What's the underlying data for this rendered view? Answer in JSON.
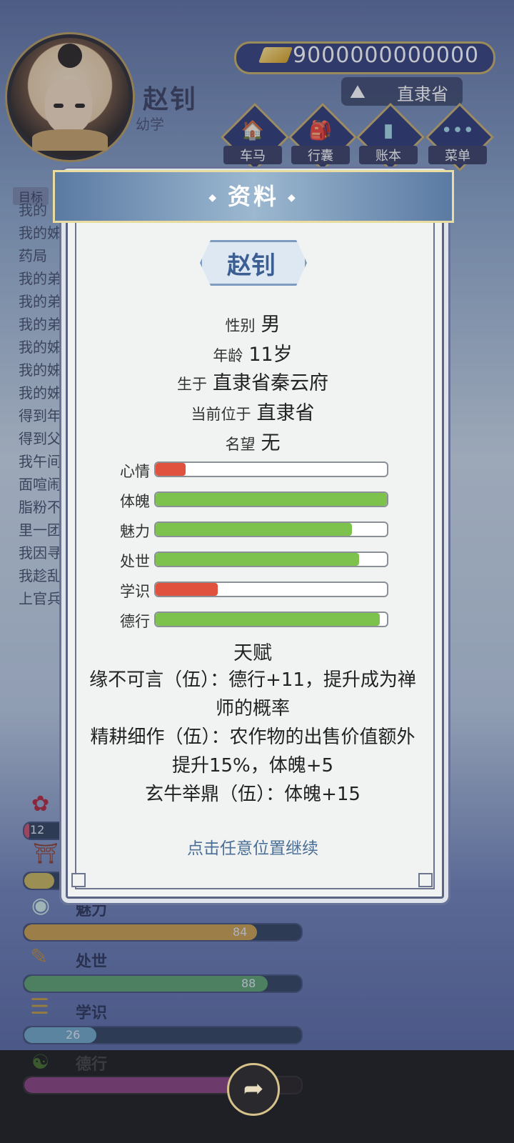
{
  "header": {
    "player_name": "赵钊",
    "player_stage": "幼学",
    "money": "9000000000000",
    "province": "直隶省",
    "menu": [
      {
        "label": "车马",
        "icon": "carriage-icon"
      },
      {
        "label": "行囊",
        "icon": "bag-icon"
      },
      {
        "label": "账本",
        "icon": "ledger-icon"
      },
      {
        "label": "菜单",
        "icon": "more-icon"
      }
    ]
  },
  "background_log": {
    "goal_label": "目标",
    "lines": [
      "我的",
      "我的姊                                                                                  入尚",
      "药局",
      "我的弟",
      "我的弟",
      "我的弟",
      "我的姊",
      "我的姊",
      "我的姊",
      "得到年",
      "得到父",
      "我午间                                                                                  得里",
      "面喧闹                                                                                  所售",
      "脂粉不                                                                                  铺子",
      "里一团",
      "我因寻",
      "我趁乱                                                                                  ，遇",
      "上官兵"
    ]
  },
  "background_stats": [
    {
      "label": "",
      "value": "12",
      "fraction": 0.12,
      "color": "#c7506b"
    },
    {
      "label": "",
      "value": "",
      "fraction": 0.7,
      "color": "#c9b55a"
    },
    {
      "label": "魅力",
      "value": "84",
      "fraction": 0.84,
      "color": "#c99d4b"
    },
    {
      "label": "处世",
      "value": "88",
      "fraction": 0.88,
      "color": "#5aa06c"
    },
    {
      "label": "学识",
      "value": "26",
      "fraction": 0.26,
      "color": "#6fa6c4"
    },
    {
      "label": "德行",
      "value": "",
      "fraction": 0.9,
      "color": "#6d3a6c"
    }
  ],
  "modal": {
    "title": "资料",
    "name": "赵钊",
    "info": [
      {
        "key": "性别",
        "value": "男"
      },
      {
        "key": "年龄",
        "value": "11岁"
      },
      {
        "key": "生于",
        "value": "直隶省秦云府"
      },
      {
        "key": "当前位于",
        "value": "直隶省"
      },
      {
        "key": "名望",
        "value": "无"
      }
    ],
    "stats": [
      {
        "label": "心情",
        "fraction": 0.13,
        "color": "#e0513e"
      },
      {
        "label": "体魄",
        "fraction": 1.0,
        "color": "#7ec24e"
      },
      {
        "label": "魅力",
        "fraction": 0.85,
        "color": "#7ec24e"
      },
      {
        "label": "处世",
        "fraction": 0.88,
        "color": "#7ec24e"
      },
      {
        "label": "学识",
        "fraction": 0.27,
        "color": "#e0513e"
      },
      {
        "label": "德行",
        "fraction": 0.97,
        "color": "#7ec24e"
      }
    ],
    "talent_title": "天赋",
    "talents": [
      "缘不可言（伍）：德行+11，提升成为禅师的概率",
      "精耕细作（伍）：农作物的出售价值额外提升15%，体魄+5",
      "玄牛举鼎（伍）：体魄+15"
    ],
    "continue_hint": "点击任意位置继续"
  },
  "footer": {
    "share_icon": "share-icon"
  }
}
